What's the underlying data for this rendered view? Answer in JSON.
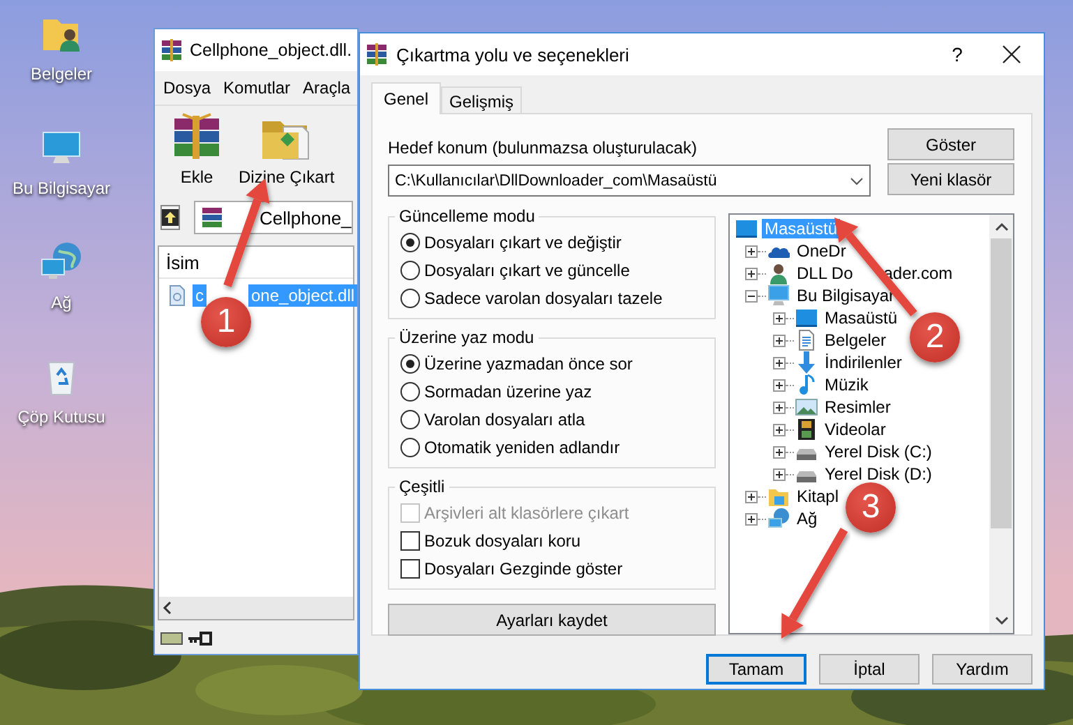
{
  "desktop": {
    "icons": [
      {
        "label": "Belgeler",
        "kind": "user-folder"
      },
      {
        "label": "Bu Bilgisayar",
        "kind": "computer"
      },
      {
        "label": "Ağ",
        "kind": "network"
      },
      {
        "label": "Çöp Kutusu",
        "kind": "recycle-bin"
      }
    ]
  },
  "winrar_window": {
    "title": "Cellphone_object.dll.",
    "menu": [
      "Dosya",
      "Komutlar",
      "Araçla"
    ],
    "toolbar": [
      {
        "label": "Ekle",
        "kind": "add"
      },
      {
        "label": "Dizine Çıkart",
        "kind": "extract"
      }
    ],
    "address": "Cellphone_",
    "columns": [
      "İsim"
    ],
    "files": [
      {
        "name": "c",
        "name_after_badge": "one_object.dll",
        "selected": true
      }
    ]
  },
  "dialog": {
    "title": "Çıkartma yolu ve seçenekleri",
    "help": "?",
    "tabs": [
      {
        "label": "Genel",
        "selected": true
      },
      {
        "label": "Gelişmiş",
        "selected": false
      }
    ],
    "destination_label": "Hedef konum (bulunmazsa oluşturulacak)",
    "destination_value": "C:\\Kullanıcılar\\DllDownloader_com\\Masaüstü",
    "side_buttons": [
      "Göster",
      "Yeni klasör"
    ],
    "groups": [
      {
        "title": "Güncelleme modu",
        "kind": "radio",
        "options": [
          {
            "label": "Dosyaları çıkart ve değiştir",
            "selected": true
          },
          {
            "label": "Dosyaları çıkart ve güncelle",
            "selected": false
          },
          {
            "label": "Sadece varolan dosyaları tazele",
            "selected": false
          }
        ]
      },
      {
        "title": "Üzerine yaz modu",
        "kind": "radio",
        "options": [
          {
            "label": "Üzerine yazmadan önce sor",
            "selected": true
          },
          {
            "label": "Sormadan üzerine yaz",
            "selected": false
          },
          {
            "label": "Varolan dosyaları atla",
            "selected": false
          },
          {
            "label": "Otomatik yeniden adlandır",
            "selected": false
          }
        ]
      },
      {
        "title": "Çeşitli",
        "kind": "checkbox",
        "options": [
          {
            "label": "Arşivleri alt klasörlere çıkart",
            "checked": false,
            "disabled": true
          },
          {
            "label": "Bozuk dosyaları koru",
            "checked": false,
            "disabled": false
          },
          {
            "label": "Dosyaları Gezginde göster",
            "checked": false,
            "disabled": false
          }
        ]
      }
    ],
    "save_button": "Ayarları kaydet",
    "tree": [
      {
        "label": "Masaüstü",
        "kind": "desktop",
        "selected": true,
        "children": [
          {
            "label": "OneDr",
            "kind": "cloud",
            "expanded": false,
            "selected": false
          },
          {
            "label": "DLL Do",
            "label_after_arrow": "ader.com",
            "kind": "user",
            "expanded": false,
            "selected": false
          },
          {
            "label": "Bu Bilgisayar",
            "kind": "computer",
            "expanded": true,
            "selected": false,
            "children": [
              {
                "label": "Masaüstü",
                "kind": "desktop",
                "expanded": false,
                "selected": false
              },
              {
                "label": "Belgeler",
                "kind": "document",
                "expanded": false,
                "selected": false
              },
              {
                "label": "İndirilenler",
                "kind": "download",
                "expanded": false,
                "selected": false
              },
              {
                "label": "Müzik",
                "kind": "music",
                "expanded": false,
                "selected": false
              },
              {
                "label": "Resimler",
                "expanded": false,
                "selected": false
              },
              {
                "label": "Videolar",
                "kind": "video",
                "expanded": false,
                "selected": false
              },
              {
                "label": "Yerel Disk (C:)",
                "kind": "disk",
                "expanded": false,
                "selected": false
              },
              {
                "label": "Yerel Disk (D:)",
                "kind": "disk",
                "expanded": false,
                "selected": false
              }
            ]
          },
          {
            "label": "Kitapl",
            "kind": "library",
            "expanded": false,
            "selected": false
          },
          {
            "label": "Ağ",
            "kind": "network",
            "expanded": false,
            "selected": false
          }
        ]
      }
    ],
    "buttons": [
      {
        "label": "Tamam",
        "focused": true
      },
      {
        "label": "İptal",
        "focused": false
      },
      {
        "label": "Yardım",
        "focused": false
      }
    ]
  },
  "annotations": [
    {
      "number": "1"
    },
    {
      "number": "2"
    },
    {
      "number": "3"
    }
  ]
}
